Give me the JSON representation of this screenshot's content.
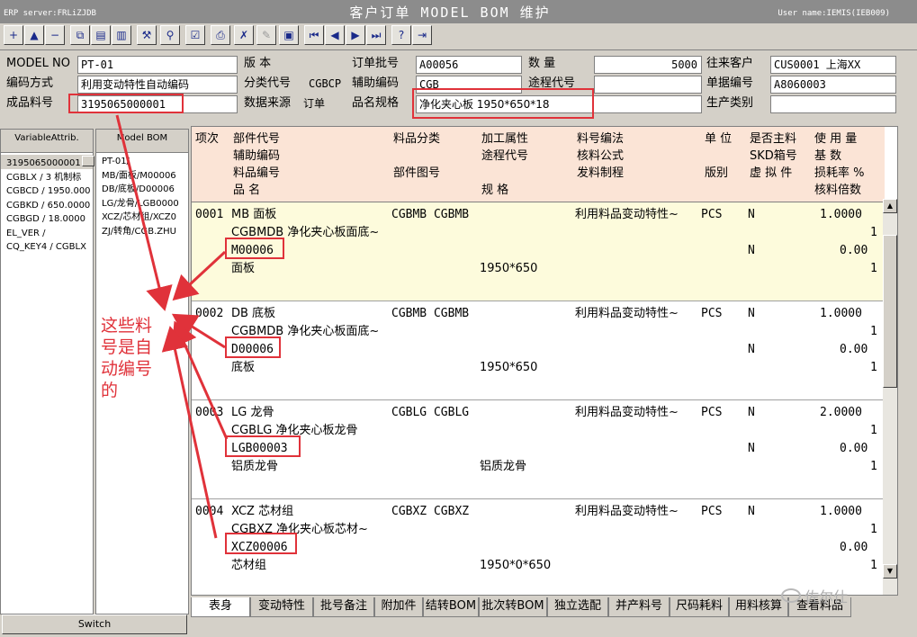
{
  "window": {
    "server": "ERP server:FRLiZJDB",
    "title": "客户订单 MODEL BOM 维护",
    "user": "User name:IEMIS(IEB009)"
  },
  "toolbar": {
    "buttons": [
      {
        "icon": "add-icon",
        "glyph": "+",
        "enabled": true
      },
      {
        "icon": "insert-icon",
        "glyph": "▲",
        "enabled": true
      },
      {
        "icon": "delete-icon",
        "glyph": "−",
        "enabled": true
      },
      {
        "icon": "copy-icon",
        "glyph": "⧉",
        "enabled": true
      },
      {
        "icon": "paste-icon",
        "glyph": "▤",
        "enabled": true
      },
      {
        "icon": "clipboard-icon",
        "glyph": "▥",
        "enabled": true
      },
      {
        "icon": "hammer-icon",
        "glyph": "⚒",
        "enabled": true
      },
      {
        "icon": "search-icon",
        "glyph": "⚲",
        "enabled": true
      },
      {
        "icon": "check-icon",
        "glyph": "☑",
        "enabled": true
      },
      {
        "icon": "print-icon",
        "glyph": "⎙",
        "enabled": true
      },
      {
        "icon": "spellcheck-icon",
        "glyph": "✗",
        "enabled": true
      },
      {
        "icon": "tools-icon",
        "glyph": "✎",
        "enabled": false
      },
      {
        "icon": "save-icon",
        "glyph": "▣",
        "enabled": true
      },
      {
        "icon": "first-record-icon",
        "glyph": "⏮",
        "enabled": true
      },
      {
        "icon": "previous-record-icon",
        "glyph": "◀",
        "enabled": true
      },
      {
        "icon": "next-record-icon",
        "glyph": "▶",
        "enabled": true
      },
      {
        "icon": "last-record-icon",
        "glyph": "⏭",
        "enabled": true
      },
      {
        "icon": "help-icon",
        "glyph": "?",
        "enabled": true
      },
      {
        "icon": "exit-icon",
        "glyph": "⇥",
        "enabled": true
      }
    ]
  },
  "header": {
    "model_no_label": "MODEL NO",
    "model_no": "PT-01",
    "version_label": "版   本",
    "version": "",
    "order_batch_label": "订单批号",
    "order_batch": "A00056",
    "quantity_label": "数   量",
    "quantity": "5000",
    "customer_label": "往来客户",
    "customer": "CUS0001 上海XX",
    "coding_method_label": "编码方式",
    "coding_method": "利用变动特性自动编码",
    "category_code_label": "分类代号",
    "category_code": "CGBCP",
    "aux_code_label": "辅助编码",
    "aux_code": "CGB",
    "route_code_label": "途程代号",
    "route_code": "",
    "doc_no_label": "单据编号",
    "doc_no": "A8060003",
    "finished_no_label": "成品料号",
    "finished_no": "3195065000001",
    "data_source_label": "数据来源",
    "data_source": "订单",
    "spec_label": "品名规格",
    "spec": "净化夹心板 1950*650*18",
    "production_type_label": "生产类别",
    "production_type": ""
  },
  "left_panel_1": {
    "header": "VariableAttrib.",
    "items": [
      "3195065000001",
      "CGBLX / 3 机制标",
      "CGBCD / 1950.000",
      "CGBKD / 650.0000",
      "CGBGD / 18.0000",
      "EL_VER /",
      "CQ_KEY4 / CGBLX"
    ]
  },
  "left_panel_2": {
    "header": "Model BOM",
    "items": [
      "PT-01/",
      "MB/面板/M00006",
      "DB/底板/D00006",
      "LG/龙骨/LGB0000",
      "XCZ/芯材组/XCZ0",
      "ZJ/转角/CGB.ZHU"
    ]
  },
  "switch_label": "Switch",
  "grid_header": {
    "seq": "项次",
    "part_code": "部件代号",
    "aux_code": "辅助编码",
    "item_no": "料品编号",
    "item_name": "品   名",
    "category": "料品分类",
    "part_drawing": "部件图号",
    "process_attr": "加工属性",
    "route_code": "途程代号",
    "spec": "规   格",
    "coding_method": "料号编法",
    "check_formula": "核料公式",
    "issue_system": "发料制程",
    "unit": "单 位",
    "version": "版别",
    "is_main": "是否主料",
    "skd_box": "SKD箱号",
    "phantom": "虚 拟 件",
    "usage": "使 用 量",
    "base_qty": "基   数",
    "loss_rate": "损耗率 %",
    "check_multiple": "核料倍数"
  },
  "rows": [
    {
      "seq": "0001",
      "part": "MB 面板",
      "category": "CGBMB CGBMB",
      "aux": "CGBMDB 净化夹心板面底~",
      "item_no": "M00006",
      "name": "面板",
      "spec": "1950*650",
      "method": "利用料品变动特性~",
      "unit": "PCS",
      "main": "N",
      "phantom": "N",
      "usage": "1.0000",
      "base": "1",
      "loss": "0.00",
      "mult": "1"
    },
    {
      "seq": "0002",
      "part": "DB 底板",
      "category": "CGBMB CGBMB",
      "aux": "CGBMDB 净化夹心板面底~",
      "item_no": "D00006",
      "name": "底板",
      "spec": "1950*650",
      "method": "利用料品变动特性~",
      "unit": "PCS",
      "main": "N",
      "phantom": "N",
      "usage": "1.0000",
      "base": "1",
      "loss": "0.00",
      "mult": "1"
    },
    {
      "seq": "0003",
      "part": "LG 龙骨",
      "category": "CGBLG CGBLG",
      "aux": "CGBLG 净化夹心板龙骨",
      "item_no": "LGB00003",
      "name": "铝质龙骨",
      "spec": "铝质龙骨",
      "method": "利用料品变动特性~",
      "unit": "PCS",
      "main": "N",
      "phantom": "N",
      "usage": "2.0000",
      "base": "1",
      "loss": "0.00",
      "mult": "1"
    },
    {
      "seq": "0004",
      "part": "XCZ 芯材组",
      "category": "CGBXZ CGBXZ",
      "aux": "CGBXZ 净化夹心板芯材~",
      "item_no": "XCZ00006",
      "name": "芯材组",
      "spec": "1950*0*650",
      "method": "利用料品变动特性~",
      "unit": "PCS",
      "main": "N",
      "phantom": "",
      "usage": "1.0000",
      "base": "1",
      "loss": "0.00",
      "mult": "1"
    }
  ],
  "tabs": [
    "表身",
    "变动特性",
    "批号备注",
    "附加件",
    "结转BOM",
    "批次转BOM",
    "独立选配",
    "并产料号",
    "尺码耗料",
    "用料核算",
    "查看料品"
  ],
  "annotation": {
    "text": "这些料号是自动编号的",
    "color": "#e0323a"
  },
  "watermark": "佐尔仕"
}
